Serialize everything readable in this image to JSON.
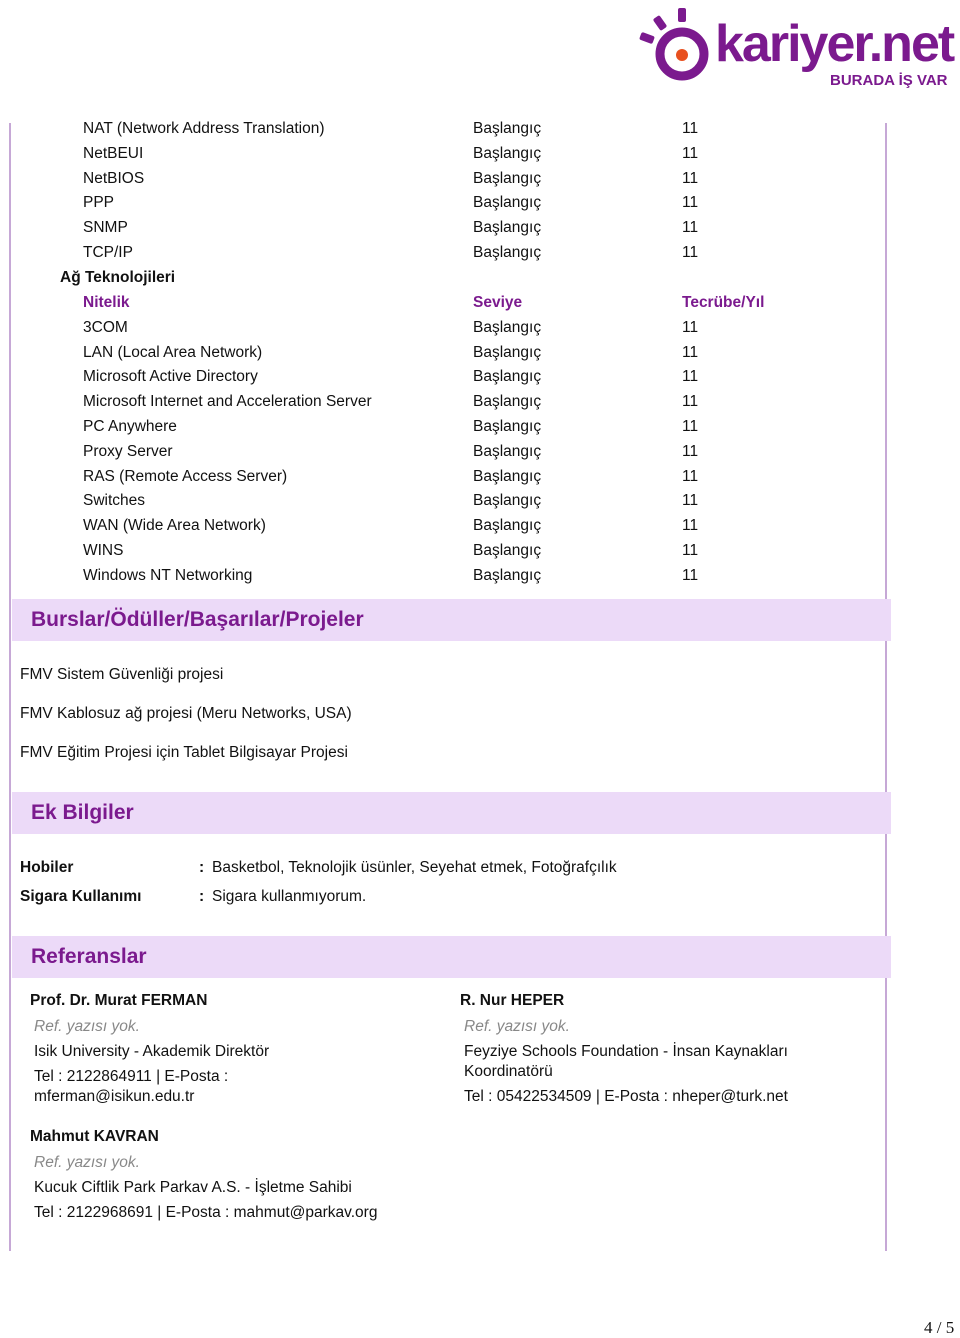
{
  "brand": {
    "name": "kariyer.net",
    "tagline": "BURADA İŞ VAR",
    "colors": {
      "primary": "#7b1a8e",
      "accent_dot": "#e8501f",
      "section_bg": "#ecdaf8",
      "frame": "#c6a8d6"
    }
  },
  "protocols": {
    "rows": [
      {
        "name": "NAT (Network Address Translation)",
        "level": "Başlangıç",
        "years": "11"
      },
      {
        "name": "NetBEUI",
        "level": "Başlangıç",
        "years": "11"
      },
      {
        "name": "NetBIOS",
        "level": "Başlangıç",
        "years": "11"
      },
      {
        "name": "PPP",
        "level": "Başlangıç",
        "years": "11"
      },
      {
        "name": "SNMP",
        "level": "Başlangıç",
        "years": "11"
      },
      {
        "name": "TCP/IP",
        "level": "Başlangıç",
        "years": "11"
      }
    ]
  },
  "network_tech": {
    "title": "Ağ Teknolojileri",
    "headers": {
      "skill": "Nitelik",
      "level": "Seviye",
      "years": "Tecrübe/Yıl"
    },
    "rows": [
      {
        "name": "3COM",
        "level": "Başlangıç",
        "years": "11"
      },
      {
        "name": "LAN (Local Area Network)",
        "level": "Başlangıç",
        "years": "11"
      },
      {
        "name": "Microsoft Active Directory",
        "level": "Başlangıç",
        "years": "11"
      },
      {
        "name": "Microsoft Internet and Acceleration Server",
        "level": "Başlangıç",
        "years": "11"
      },
      {
        "name": "PC Anywhere",
        "level": "Başlangıç",
        "years": "11"
      },
      {
        "name": "Proxy Server",
        "level": "Başlangıç",
        "years": "11"
      },
      {
        "name": "RAS (Remote Access Server)",
        "level": "Başlangıç",
        "years": "11"
      },
      {
        "name": "Switches",
        "level": "Başlangıç",
        "years": "11"
      },
      {
        "name": "WAN (Wide Area Network)",
        "level": "Başlangıç",
        "years": "11"
      },
      {
        "name": "WINS",
        "level": "Başlangıç",
        "years": "11"
      },
      {
        "name": "Windows NT Networking",
        "level": "Başlangıç",
        "years": "11"
      }
    ]
  },
  "awards": {
    "title": "Burslar/Ödüller/Başarılar/Projeler",
    "items": [
      "FMV Sistem Güvenliği projesi",
      "FMV Kablosuz ağ projesi  (Meru Networks, USA)",
      "FMV Eğitim Projesi için Tablet Bilgisayar Projesi"
    ]
  },
  "extra": {
    "title": "Ek Bilgiler",
    "items": [
      {
        "label": "Hobiler",
        "colon": ":",
        "value": "Basketbol, Teknolojik üsünler, Seyehat etmek, Fotoğrafçılık"
      },
      {
        "label": "Sigara Kullanımı",
        "colon": ":",
        "value": "Sigara kullanmıyorum."
      }
    ]
  },
  "references": {
    "title": "Referanslar",
    "items": [
      {
        "name": "Prof. Dr. Murat FERMAN",
        "note": "Ref. yazısı yok.",
        "org": "Isik University - Akademik Direktör",
        "contact": "Tel : 2122864911  |  E-Posta : mferman@isikun.edu.tr"
      },
      {
        "name": "R. Nur HEPER",
        "note": "Ref. yazısı yok.",
        "org": "Feyziye Schools Foundation - İnsan Kaynakları Koordinatörü",
        "contact": "Tel : 05422534509  |  E-Posta : nheper@turk.net"
      },
      {
        "name": "Mahmut KAVRAN",
        "note": "Ref. yazısı yok.",
        "org": "Kucuk Ciftlik Park Parkav A.S. - İşletme Sahibi",
        "contact": "Tel : 2122968691  |  E-Posta : mahmut@parkav.org"
      }
    ]
  },
  "page": {
    "indicator": "4 / 5"
  }
}
